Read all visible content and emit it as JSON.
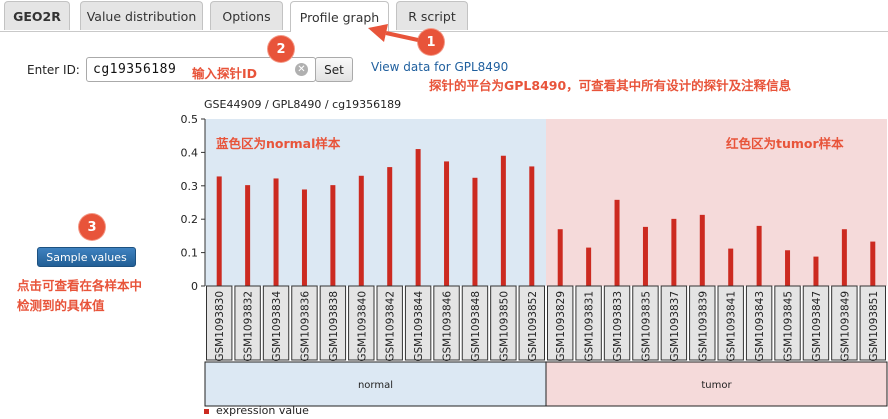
{
  "tabs": [
    {
      "label": "GEO2R",
      "active": false
    },
    {
      "label": "Value distribution",
      "active": false
    },
    {
      "label": "Options",
      "active": false
    },
    {
      "label": "Profile graph",
      "active": true
    },
    {
      "label": "R script",
      "active": false
    }
  ],
  "form": {
    "enter_id_label": "Enter ID:",
    "id_value": "cg19356189",
    "clear_symbol": "✕",
    "set_label": "Set",
    "view_data_link": "View data for GPL8490"
  },
  "annotations": {
    "badge1": "1",
    "badge2": "2",
    "badge3": "3",
    "input_probe_id": "输入探针ID",
    "platform_note": "探针的平台为GPL8490，可查看其中所有设计的探针及注释信息",
    "normal_region": "蓝色区为normal样本",
    "tumor_region": "红色区为tumor样本",
    "sample_values_note_line1": "点击可查看在各样本中",
    "sample_values_note_line2": "检测到的具体值"
  },
  "sample_values_button": "Sample values",
  "colors": {
    "bar": "#cc2a20",
    "normal_bg": "#dce8f3",
    "tumor_bg": "#f5dada",
    "annotation": "#e8543a",
    "link": "#1f5f9e"
  },
  "chart_data": {
    "type": "bar",
    "title": "GSE44909 / GPL8490 / cg19356189",
    "ylim": [
      0,
      0.5
    ],
    "yticks": [
      "0",
      "0.1",
      "0.2",
      "0.3",
      "0.4",
      "0.5"
    ],
    "grid": false,
    "groups": [
      {
        "name": "normal",
        "start": 0,
        "end": 12
      },
      {
        "name": "tumor",
        "start": 12,
        "end": 24
      }
    ],
    "categories": [
      "GSM1093830",
      "GSM1093832",
      "GSM1093834",
      "GSM1093836",
      "GSM1093838",
      "GSM1093840",
      "GSM1093842",
      "GSM1093844",
      "GSM1093846",
      "GSM1093848",
      "GSM1093850",
      "GSM1093852",
      "GSM1093829",
      "GSM1093831",
      "GSM1093833",
      "GSM1093835",
      "GSM1093837",
      "GSM1093839",
      "GSM1093841",
      "GSM1093843",
      "GSM1093845",
      "GSM1093847",
      "GSM1093849",
      "GSM1093851"
    ],
    "series": [
      {
        "name": "expression value",
        "values": [
          0.328,
          0.302,
          0.322,
          0.289,
          0.302,
          0.33,
          0.356,
          0.41,
          0.373,
          0.324,
          0.39,
          0.358,
          0.17,
          0.115,
          0.258,
          0.177,
          0.201,
          0.213,
          0.112,
          0.18,
          0.107,
          0.088,
          0.17,
          0.133
        ]
      }
    ]
  }
}
